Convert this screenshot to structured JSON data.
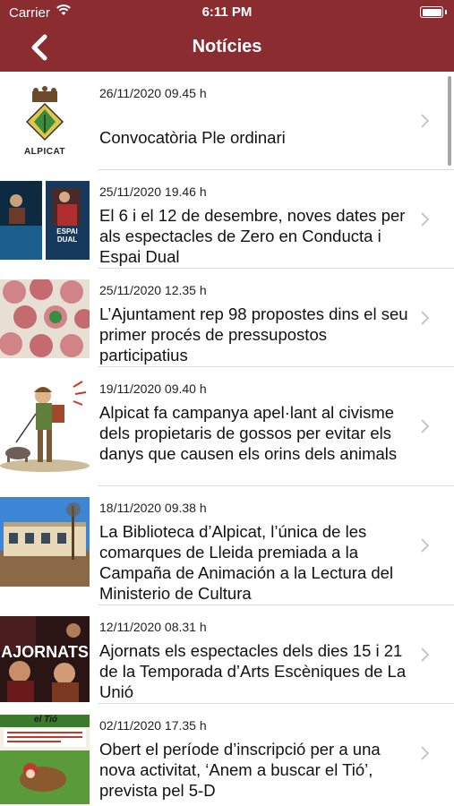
{
  "status_bar": {
    "carrier": "Carrier",
    "time": "6:11 PM"
  },
  "nav": {
    "title": "Notícies",
    "back_icon": "chevron-left-icon"
  },
  "colors": {
    "bar": "#8b2d30",
    "text": "#111111",
    "chevron": "#c7c7cc"
  },
  "news": [
    {
      "date": "26/11/2020 09.45 h",
      "title": "Convocatòria Ple ordinari",
      "logo_text": "ALPICAT"
    },
    {
      "date": "25/11/2020 19.46 h",
      "title": "El 6 i el 12 de desembre, noves dates per als espectacles de Zero en Conducta i Espai Dual",
      "image_caption": "ESPAI DUAL"
    },
    {
      "date": "25/11/2020 12.35 h",
      "title": "L’Ajuntament rep 98 propostes dins el seu primer procés de pressupostos participatius"
    },
    {
      "date": "19/11/2020 09.40 h",
      "title": "Alpicat fa campanya apel·lant al civisme dels propietaris de gossos per evitar els danys que causen els orins dels animals"
    },
    {
      "date": "18/11/2020 09.38 h",
      "title": "La Biblioteca d’Alpicat, l’única de les comarques de Lleida premiada a la Campaña de Animación a la Lectura del Ministerio de Cultura"
    },
    {
      "date": "12/11/2020 08.31 h",
      "title": "Ajornats els espectacles dels dies 15 i 21 de la Temporada d’Arts Escèniques de La Unió",
      "image_caption": "AJORNATS"
    },
    {
      "date": "02/11/2020 17.35 h",
      "title": "Obert el període d’inscripció per a una nova activitat, ‘Anem a buscar el Tió’, prevista pel 5-D",
      "image_caption": "el Tió"
    }
  ]
}
